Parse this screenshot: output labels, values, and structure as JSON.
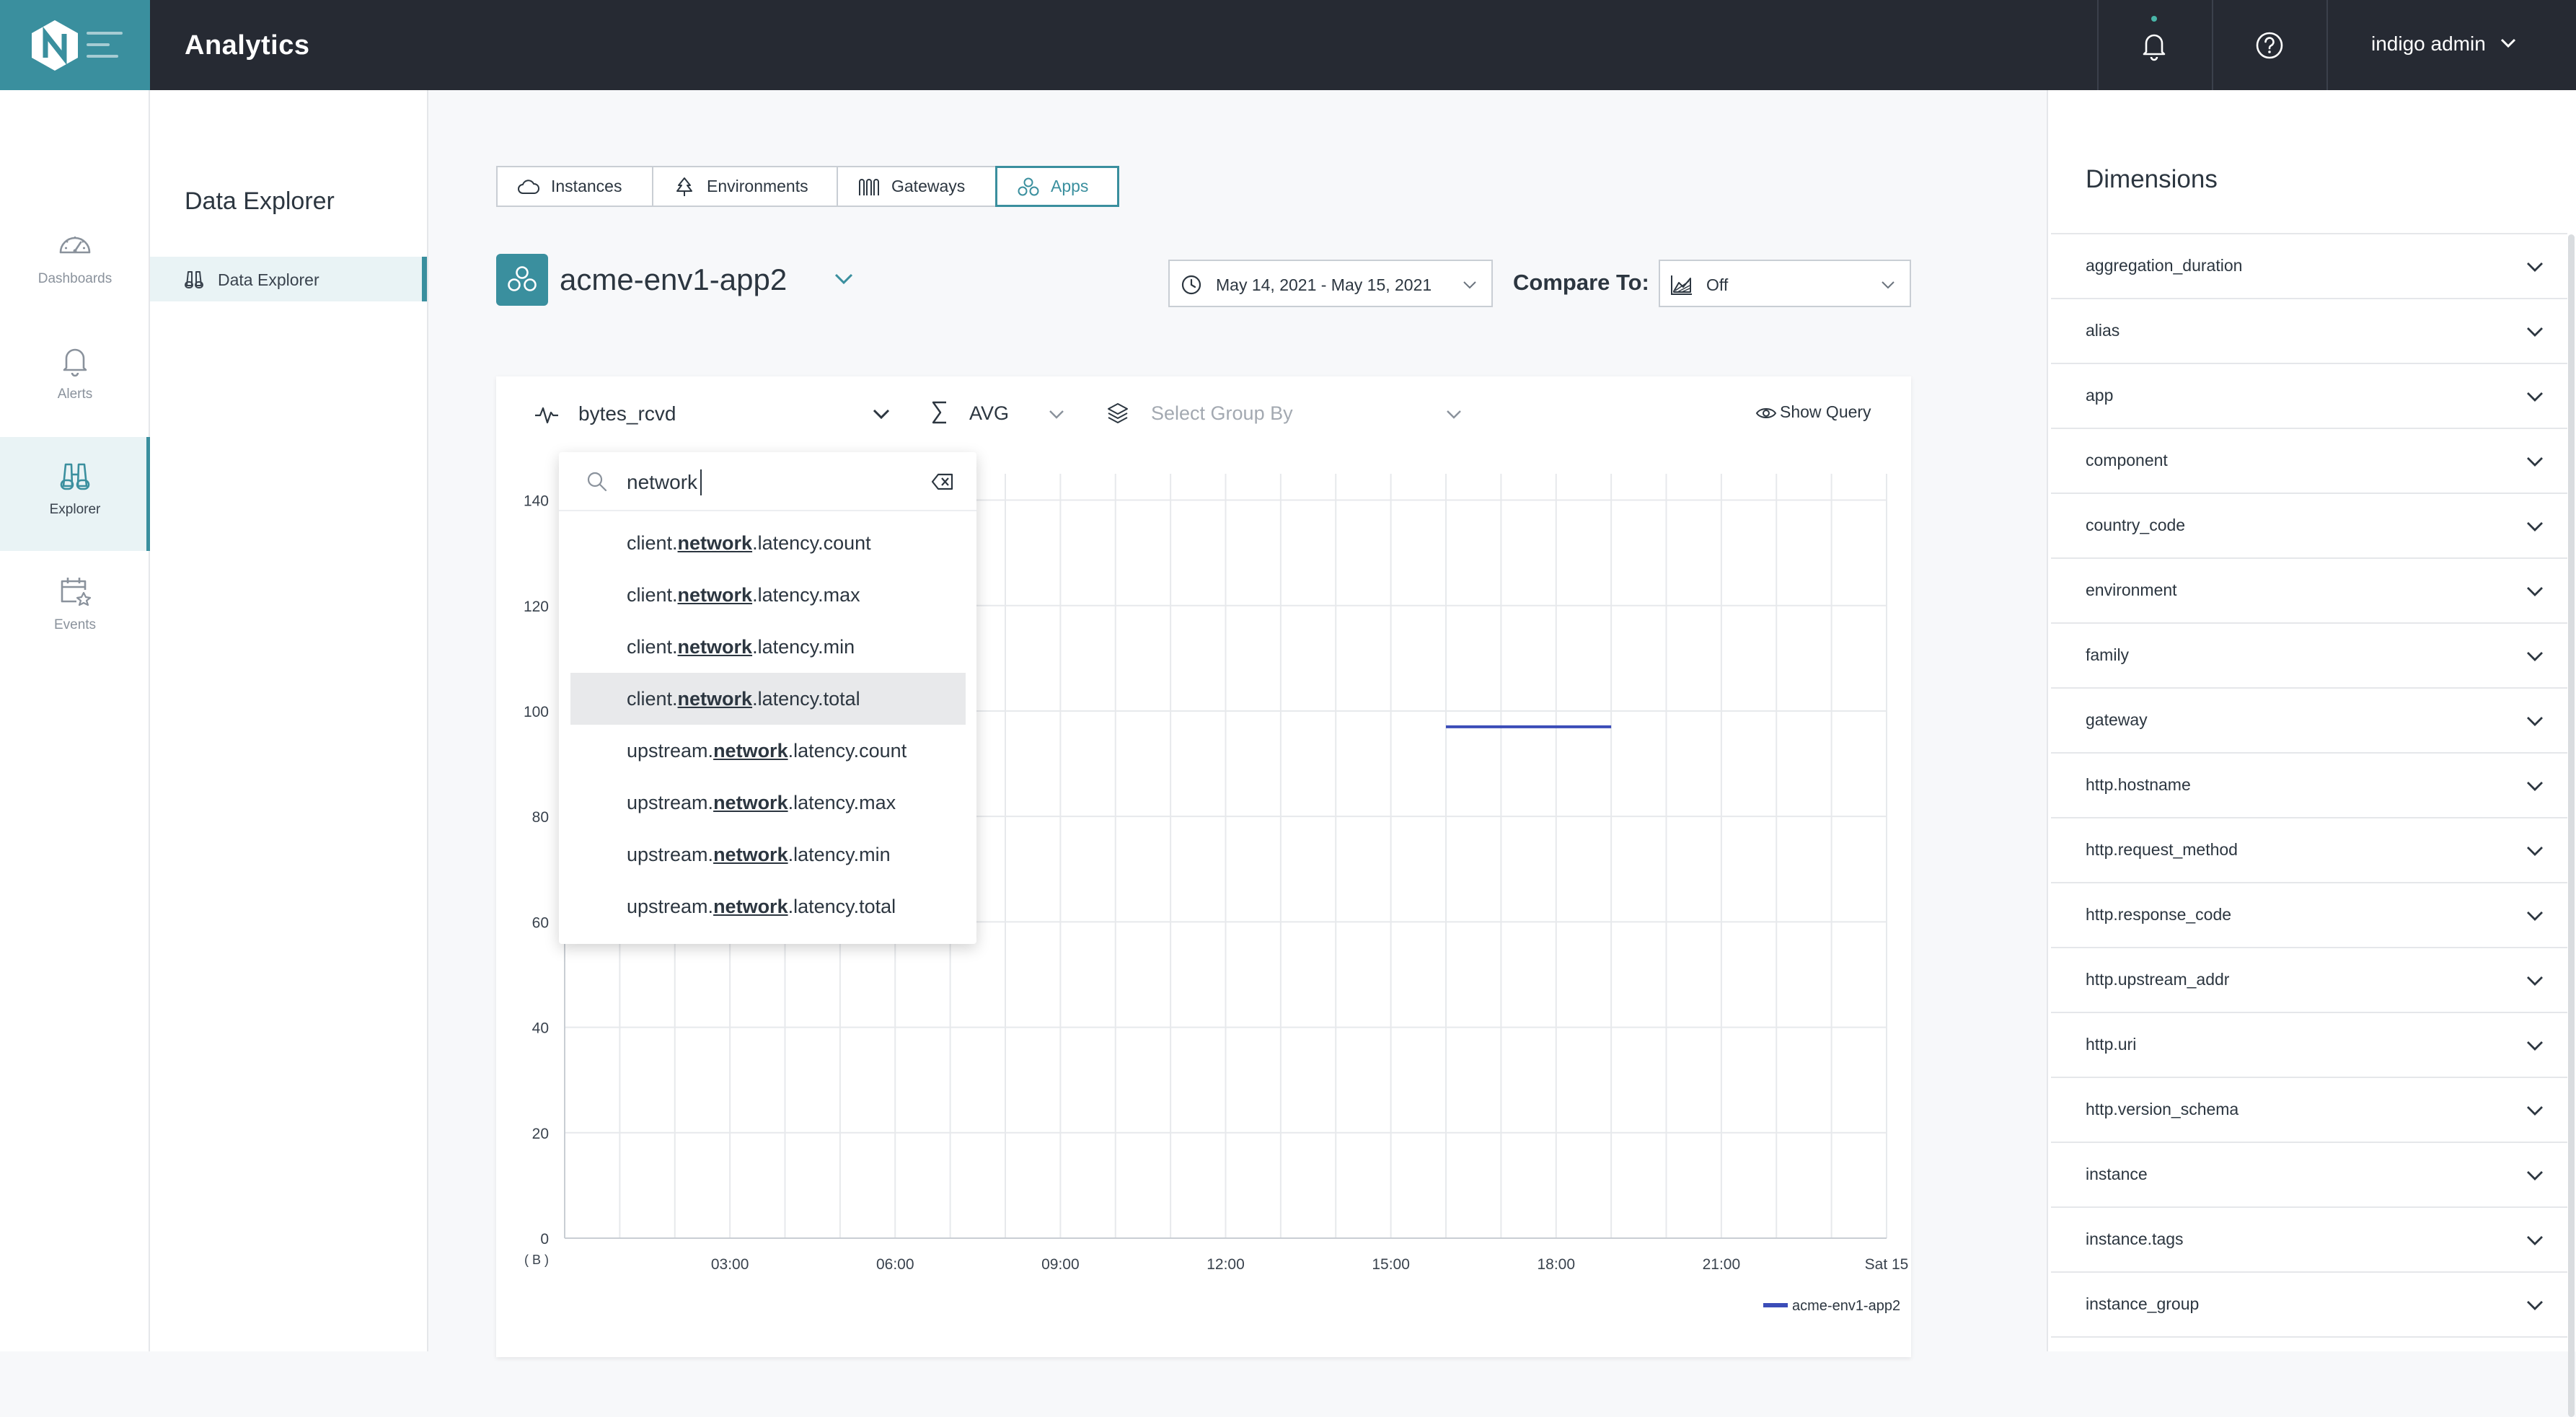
{
  "header": {
    "title": "Analytics",
    "user": "indigo admin"
  },
  "leftnav": {
    "items": [
      {
        "label": "Dashboards",
        "icon": "dashboard-gauge-icon"
      },
      {
        "label": "Alerts",
        "icon": "bell-icon"
      },
      {
        "label": "Explorer",
        "icon": "binoculars-icon",
        "active": true
      },
      {
        "label": "Events",
        "icon": "calendar-star-icon"
      }
    ]
  },
  "subnav": {
    "title": "Data Explorer",
    "items": [
      {
        "label": "Data Explorer",
        "active": true
      }
    ]
  },
  "tabs": [
    {
      "label": "Instances",
      "icon": "cloud-icon"
    },
    {
      "label": "Environments",
      "icon": "tree-icon"
    },
    {
      "label": "Gateways",
      "icon": "gateway-icon"
    },
    {
      "label": "Apps",
      "icon": "apps-icon",
      "active": true
    }
  ],
  "app": {
    "name": "acme-env1-app2"
  },
  "filters": {
    "date_range": "May 14, 2021 - May 15, 2021",
    "compare_label": "Compare To:",
    "compare_value": "Off"
  },
  "query": {
    "metric": "bytes_rcvd",
    "aggregation": "AVG",
    "group_by_placeholder": "Select Group By",
    "show_query": "Show Query"
  },
  "dropdown": {
    "search_value": "network",
    "items": [
      {
        "prefix": "client.",
        "match": "network",
        "suffix": ".latency.count"
      },
      {
        "prefix": "client.",
        "match": "network",
        "suffix": ".latency.max"
      },
      {
        "prefix": "client.",
        "match": "network",
        "suffix": ".latency.min"
      },
      {
        "prefix": "client.",
        "match": "network",
        "suffix": ".latency.total",
        "hover": true
      },
      {
        "prefix": "upstream.",
        "match": "network",
        "suffix": ".latency.count"
      },
      {
        "prefix": "upstream.",
        "match": "network",
        "suffix": ".latency.max"
      },
      {
        "prefix": "upstream.",
        "match": "network",
        "suffix": ".latency.min"
      },
      {
        "prefix": "upstream.",
        "match": "network",
        "suffix": ".latency.total"
      }
    ]
  },
  "chart_data": {
    "type": "line",
    "y_ticks": [
      0,
      20,
      40,
      60,
      80,
      100,
      120,
      140
    ],
    "ylim": [
      0,
      145
    ],
    "y_unit": "( B )",
    "x_ticks": [
      "03:00",
      "06:00",
      "09:00",
      "12:00",
      "15:00",
      "18:00",
      "21:00",
      "Sat 15"
    ],
    "xlim_hours": [
      0,
      24
    ],
    "grid": true,
    "legend_placement": "bottom-right",
    "series": [
      {
        "name": "acme-env1-app2",
        "color": "#3b4db8",
        "points": [
          [
            16,
            97
          ],
          [
            19,
            97
          ]
        ]
      }
    ]
  },
  "dimensions": {
    "title": "Dimensions",
    "items": [
      "aggregation_duration",
      "alias",
      "app",
      "component",
      "country_code",
      "environment",
      "family",
      "gateway",
      "http.hostname",
      "http.request_method",
      "http.response_code",
      "http.upstream_addr",
      "http.uri",
      "http.version_schema",
      "instance",
      "instance.tags",
      "instance_group"
    ]
  },
  "colors": {
    "brand": "#3a8f9e",
    "topbar": "#262a33",
    "series": "#3b4db8"
  }
}
